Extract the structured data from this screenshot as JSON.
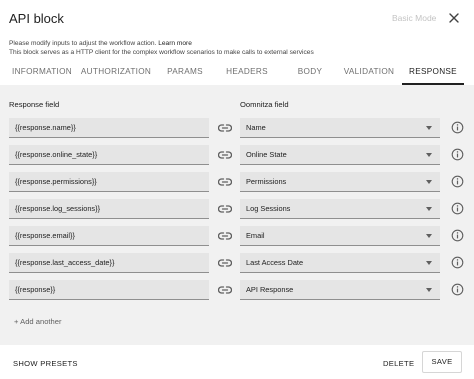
{
  "header": {
    "title": "API block",
    "mode_label": "Basic Mode",
    "close_icon": "close-icon"
  },
  "description": {
    "line1": "Please modify inputs to adjust the workflow action.",
    "learn_more": "Learn more",
    "line2": "This block serves as a HTTP client for the complex workflow scenarios to make calls to external services"
  },
  "tabs": [
    {
      "label": "INFORMATION",
      "active": false
    },
    {
      "label": "AUTHORIZATION",
      "active": false
    },
    {
      "label": "PARAMS",
      "active": false
    },
    {
      "label": "HEADERS",
      "active": false
    },
    {
      "label": "BODY",
      "active": false
    },
    {
      "label": "VALIDATION",
      "active": false
    },
    {
      "label": "RESPONSE",
      "active": true
    }
  ],
  "panel": {
    "response_field_header": "Response field",
    "oomnitza_field_header": "Oomnitza field",
    "rows": [
      {
        "response": "{{response.name}}",
        "oomnitza": "Name"
      },
      {
        "response": "{{response.online_state}}",
        "oomnitza": "Online State"
      },
      {
        "response": "{{response.permissions}}",
        "oomnitza": "Permissions"
      },
      {
        "response": "{{response.log_sessions}}",
        "oomnitza": "Log Sessions"
      },
      {
        "response": "{{response.email}}",
        "oomnitza": "Email"
      },
      {
        "response": "{{response.last_access_date}}",
        "oomnitza": "Last Access Date"
      },
      {
        "response": "{{response}}",
        "oomnitza": "API Response"
      }
    ],
    "add_another": "+ Add another"
  },
  "footer": {
    "show_presets": "SHOW PRESETS",
    "delete": "DELETE",
    "save": "SAVE"
  }
}
